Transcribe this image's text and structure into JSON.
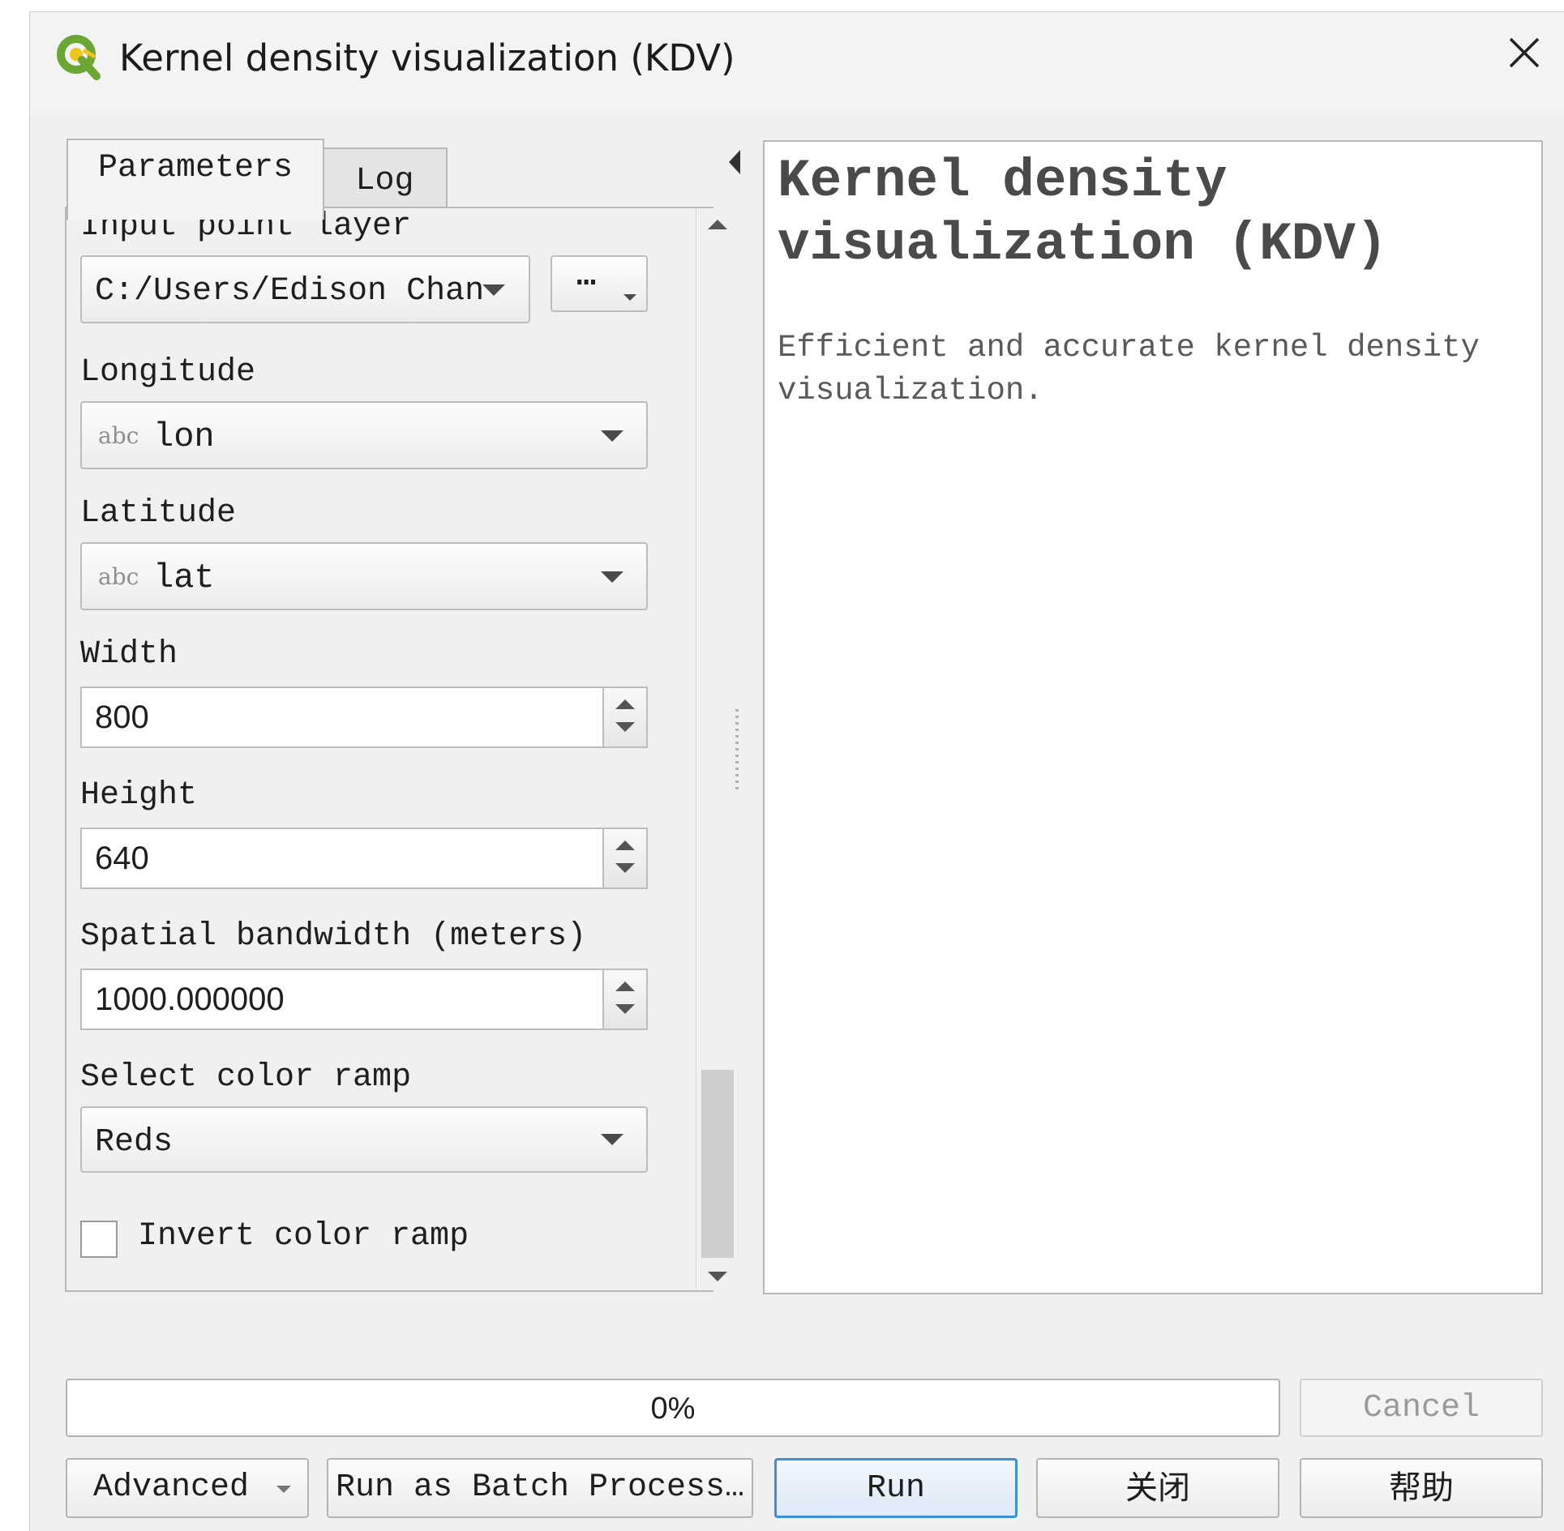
{
  "window": {
    "title": "Kernel density visualization (KDV)",
    "app_icon": "qgis-logo-icon",
    "close_icon": "close-icon"
  },
  "tabs": [
    {
      "label": "Parameters",
      "active": true
    },
    {
      "label": "Log",
      "active": false
    }
  ],
  "parameters": {
    "input_layer": {
      "label": "Input point layer",
      "value": "C:/Users/Edison Chan",
      "browse_label": "…"
    },
    "longitude": {
      "label": "Longitude",
      "field_type": "abc",
      "value": "lon"
    },
    "latitude": {
      "label": "Latitude",
      "field_type": "abc",
      "value": "lat"
    },
    "width": {
      "label": "Width",
      "value": "800"
    },
    "height": {
      "label": "Height",
      "value": "640"
    },
    "bandwidth": {
      "label": "Spatial bandwidth (meters)",
      "value": "1000.000000"
    },
    "color_ramp": {
      "label": "Select color ramp",
      "value": "Reds"
    },
    "invert": {
      "label": "Invert color ramp",
      "checked": false
    }
  },
  "help": {
    "title": "Kernel density visualization (KDV)",
    "description": "Efficient and accurate kernel density visualization."
  },
  "progress": {
    "value": 0,
    "text": "0%"
  },
  "buttons": {
    "cancel": "Cancel",
    "advanced": "Advanced",
    "batch": "Run as Batch Process…",
    "run": "Run",
    "close": "关闭",
    "help": "帮助"
  },
  "colors": {
    "accent": "#3f8edb",
    "logo_green": "#6ca635",
    "logo_yellow": "#f0c419"
  }
}
